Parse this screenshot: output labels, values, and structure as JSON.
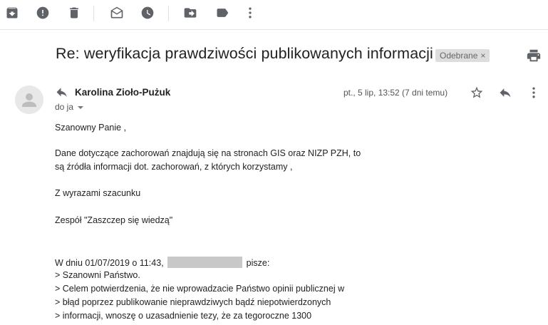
{
  "toolbar": {
    "icons": [
      "archive-icon",
      "report-spam-icon",
      "delete-icon",
      "mark-unread-icon",
      "snooze-icon",
      "move-to-icon",
      "label-icon",
      "more-icon"
    ]
  },
  "subject": {
    "title": "Re: weryfikacja prawdziwości publikowanych informacji",
    "label": "Odebrane",
    "label_close": "×"
  },
  "message": {
    "sender": "Karolina Zioło-Pużuk",
    "date": "pt., 5 lip, 13:52 (7 dni temu)",
    "recipient": "do ja",
    "body": {
      "greeting": "Szanowny Panie ,",
      "line1": "Dane dotyczące zachorowań znajdują się na stronach GIS oraz NIZP PZH, to",
      "line2": "są źródła informacji dot. zachorowań, z których korzystamy ,",
      "closing": "Z wyrazami szacunku",
      "signature": "Zespół \"Zaszczep się wiedzą\"",
      "quote_intro_before": "W dniu 01/07/2019 o 11:43,",
      "quote_intro_after": "pisze:",
      "quote1": "> Szanowni Państwo.",
      "quote2": "> Celem potwierdzenia, że nie wprowadzacie Państwo opinii publicznej w",
      "quote3": "> błąd poprzez publikowanie nieprawdziwych bądź niepotwierdzonych",
      "quote4": "> informacji, wnoszę o uzasadnienie tezy, że za tegoroczne 1300"
    }
  }
}
